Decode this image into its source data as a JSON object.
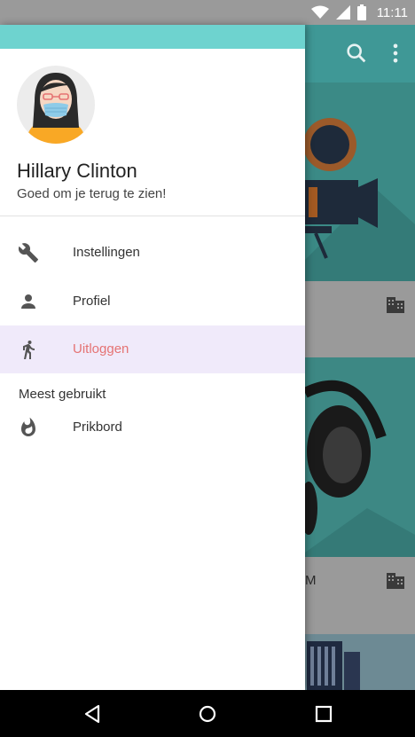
{
  "status_bar": {
    "time": "11:11",
    "icons": [
      "wifi-icon",
      "cellular-signal-icon",
      "battery-icon"
    ]
  },
  "background_app": {
    "toolbar_icons": [
      "search-icon",
      "more-vert-icon"
    ],
    "cards": [
      {
        "footer_text": "",
        "icon": "building-icon"
      },
      {
        "footer_text": "M",
        "icon": "building-icon"
      }
    ]
  },
  "drawer": {
    "header": {
      "name": "Hillary Clinton",
      "subtitle": "Goed om je terug te zien!"
    },
    "items": [
      {
        "label": "Instellingen",
        "icon": "wrench-icon",
        "active": false
      },
      {
        "label": "Profiel",
        "icon": "person-icon",
        "active": false
      },
      {
        "label": "Uitloggen",
        "icon": "walking-person-icon",
        "active": true
      }
    ],
    "section_title": "Meest gebruikt",
    "section_items": [
      {
        "label": "Prikbord",
        "icon": "flame-icon"
      }
    ]
  },
  "colors": {
    "drawer_top": "#6ed3cf",
    "active_bg": "#f0eafa",
    "active_text": "#e57373"
  },
  "nav_bar": {
    "buttons": [
      "back-icon",
      "home-icon",
      "recents-icon"
    ]
  }
}
